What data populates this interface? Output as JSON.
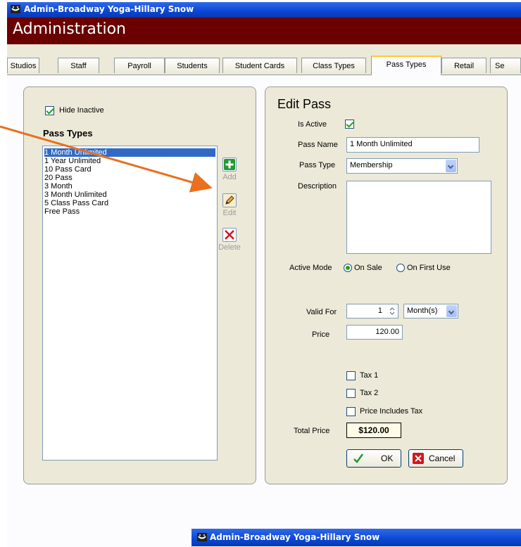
{
  "window": {
    "title": "Admin-Broadway Yoga-Hillary Snow"
  },
  "header": {
    "title": "Administration"
  },
  "tabs": [
    "Studios",
    "Staff",
    "Payroll",
    "Students",
    "Student Cards",
    "Class Types",
    "Pass Types",
    "Retail",
    "Se"
  ],
  "active_tab": "Pass Types",
  "left_panel": {
    "hide_inactive_label": "Hide Inactive",
    "hide_inactive_checked": true,
    "list_title": "Pass Types",
    "items": [
      "1 Month Unlimited",
      "1 Year Unlimited",
      "10 Pass Card",
      "20 Pass",
      "3 Month",
      "3 Month Unlimited",
      "5 Class Pass Card",
      "Free Pass"
    ],
    "selected_item": "1 Month Unlimited",
    "buttons": {
      "add": "Add",
      "edit": "Edit",
      "delete": "Delete"
    }
  },
  "edit_pass": {
    "title": "Edit Pass",
    "is_active_label": "Is Active",
    "is_active_checked": true,
    "pass_name_label": "Pass Name",
    "pass_name_value": "1 Month Unlimited",
    "pass_type_label": "Pass Type",
    "pass_type_value": "Membership",
    "description_label": "Description",
    "description_value": "",
    "active_mode_label": "Active Mode",
    "active_mode_options": [
      "On Sale",
      "On First Use"
    ],
    "active_mode_selected": "On Sale",
    "valid_for_label": "Valid For",
    "valid_for_value": "1",
    "valid_for_unit": "Month(s)",
    "price_label": "Price",
    "price_value": "120.00",
    "tax1_label": "Tax 1",
    "tax2_label": "Tax 2",
    "price_includes_tax_label": "Price Includes Tax",
    "total_price_label": "Total Price",
    "total_price_value": "$120.00",
    "ok_label": "OK",
    "cancel_label": "Cancel"
  },
  "taskbar": {
    "title": "Admin-Broadway Yoga-Hillary Snow"
  },
  "colors": {
    "title_blue": "#0a46d4",
    "admin_bar": "#6a0000",
    "annotation_arrow": "#e8701f",
    "selection": "#316ac5"
  },
  "icons": [
    "app-icon",
    "add-icon",
    "edit-pencil-icon",
    "delete-x-icon",
    "checkmark-icon",
    "cancel-x-icon",
    "spinner-icon",
    "dropdown-arrow-icon",
    "annotation-arrow"
  ]
}
